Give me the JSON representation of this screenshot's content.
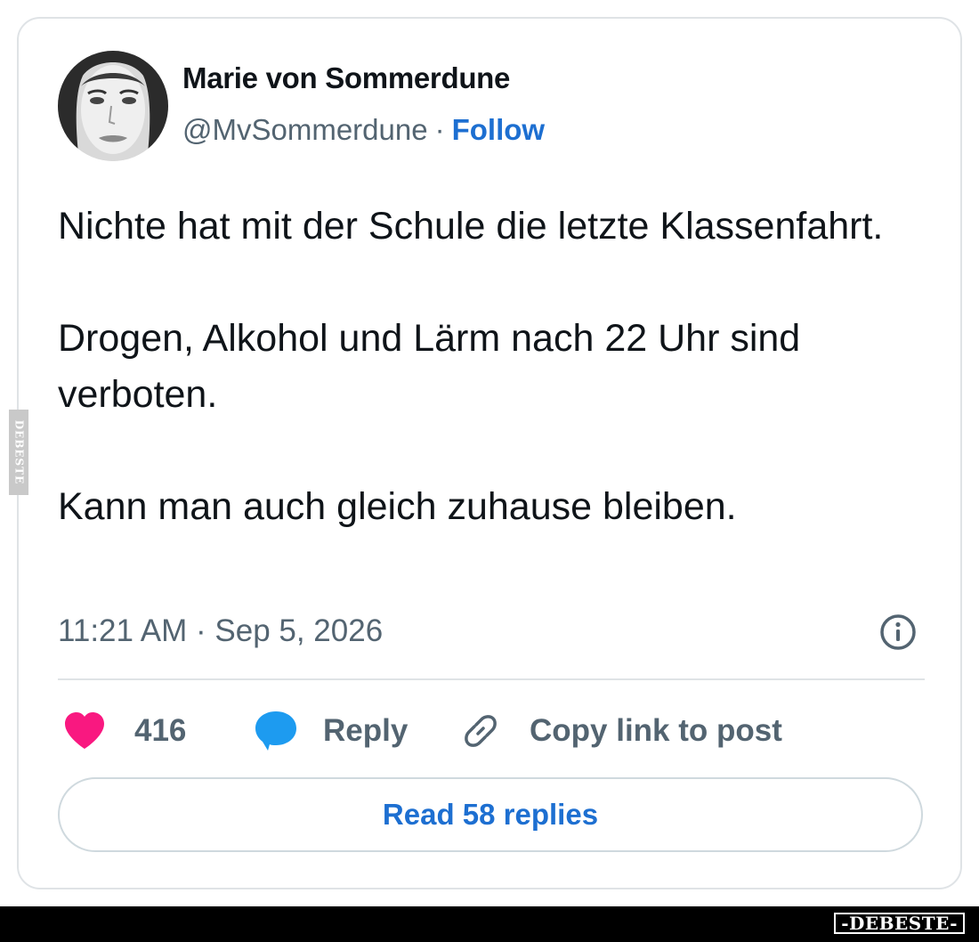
{
  "tweet": {
    "author_name": "Marie von Sommerdune",
    "handle": "@MvSommerdune",
    "separator": "·",
    "follow_label": "Follow",
    "paragraphs": [
      "Nichte hat mit der Schule die letzte Klassenfahrt.",
      "Drogen, Alkohol und Lärm nach 22 Uhr sind verboten.",
      "Kann man auch gleich zuhause bleiben."
    ],
    "timestamp": "11:21 AM · Sep 5, 2026",
    "info_icon": "info-icon"
  },
  "actions": {
    "like_icon": "heart-icon",
    "like_count": "416",
    "like_color": "#f91880",
    "reply_icon": "speech-bubble-icon",
    "reply_label": "Reply",
    "reply_color": "#1d9bf0",
    "copy_icon": "link-icon",
    "copy_label": "Copy link to post"
  },
  "read_replies_label": "Read 58 replies",
  "watermark": {
    "side_text": "DEBESTE",
    "footer_logo": "-DEBESTE-"
  },
  "colors": {
    "accent": "#1d6fd1",
    "muted_text": "#536471",
    "border": "#dfe3e6"
  }
}
